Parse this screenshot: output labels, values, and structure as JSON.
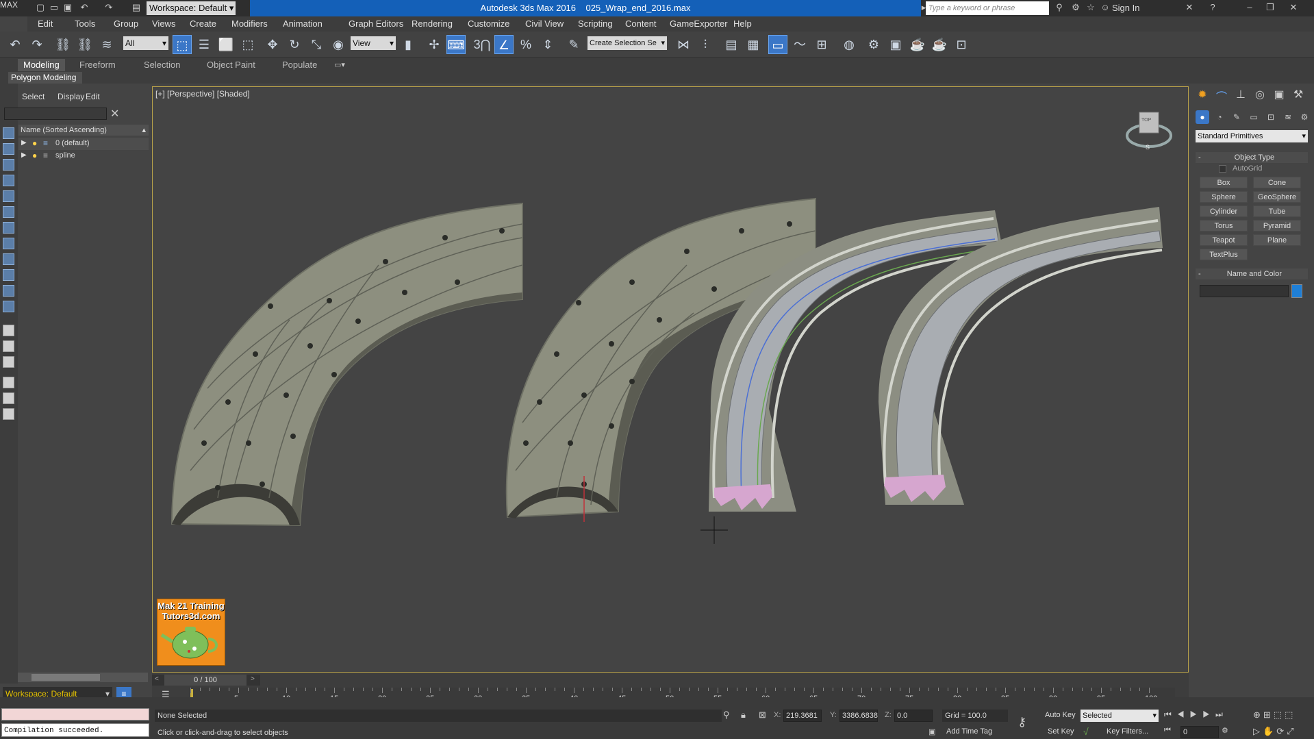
{
  "app": {
    "title": "Autodesk 3ds Max 2016",
    "file": "025_Wrap_end_2016.max",
    "logo": "MAX",
    "workspace_label": "Workspace: Default",
    "search_placeholder": "Type a keyword or phrase",
    "sign_in": "Sign In"
  },
  "menu": [
    "Edit",
    "Tools",
    "Group",
    "Views",
    "Create",
    "Modifiers",
    "Animation",
    "Graph Editors",
    "Rendering",
    "Customize",
    "Civil View",
    "Scripting",
    "Content",
    "GameExporter",
    "Help"
  ],
  "toolbar": {
    "selection_filter": "All",
    "ref_coord": "View",
    "selection_set": "Create Selection Se",
    "snap_label": "3"
  },
  "ribbon": {
    "tabs": [
      "Modeling",
      "Freeform",
      "Selection",
      "Object Paint",
      "Populate"
    ],
    "active_tab": "Modeling",
    "subpanel": "Polygon Modeling"
  },
  "explorer": {
    "menu": [
      "Select",
      "Display",
      "Edit"
    ],
    "column_header": "Name (Sorted Ascending)",
    "layers": [
      "0 (default)",
      "spline"
    ],
    "workspace": "Workspace: Default"
  },
  "viewport": {
    "label": "[+] [Perspective] [Shaded]",
    "watermark_line1": "Mak 21 Training",
    "watermark_line2": "Tutors3d.com",
    "viewcube_top": "TOP",
    "viewcube_front": "S"
  },
  "command_panel": {
    "category": "Standard Primitives",
    "rollout_object_type": "Object Type",
    "autogrid": "AutoGrid",
    "buttons": [
      "Box",
      "Cone",
      "Sphere",
      "GeoSphere",
      "Cylinder",
      "Tube",
      "Torus",
      "Pyramid",
      "Teapot",
      "Plane",
      "TextPlus"
    ],
    "rollout_name_color": "Name and Color",
    "object_color": "#1f7fd6"
  },
  "timeline": {
    "frame_display": "0 / 100",
    "ticks": [
      "5",
      "10",
      "15",
      "20",
      "25",
      "30",
      "35",
      "40",
      "45",
      "50",
      "55",
      "60",
      "65",
      "70",
      "75",
      "80",
      "85",
      "90",
      "95",
      "100"
    ]
  },
  "status": {
    "maxscript_output": "Compilation succeeded.",
    "selection": "None Selected",
    "prompt": "Click or click-and-drag to select objects",
    "x_label": "X:",
    "x": "219.3681",
    "y_label": "Y:",
    "y": "3386.6838",
    "z_label": "Z:",
    "z": "0.0",
    "grid": "Grid = 100.0",
    "add_time_tag": "Add Time Tag",
    "auto_key": "Auto Key",
    "set_key": "Set Key",
    "key_mode": "Selected",
    "key_filters": "Key Filters...",
    "current_frame": "0"
  }
}
